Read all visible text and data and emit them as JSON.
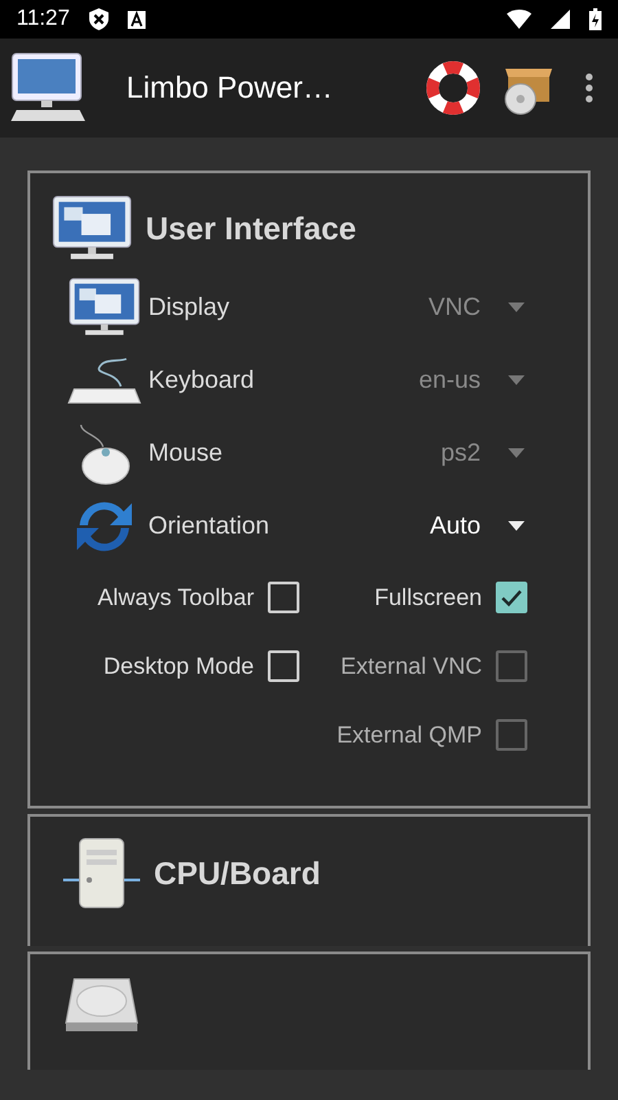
{
  "status_bar": {
    "time": "11:27"
  },
  "app_bar": {
    "title": "Limbo Power…"
  },
  "sections": [
    {
      "kind": "settings",
      "title": "User Interface",
      "dropdowns": [
        {
          "label": "Display",
          "value": "VNC",
          "disabled": true
        },
        {
          "label": "Keyboard",
          "value": "en-us",
          "disabled": true
        },
        {
          "label": "Mouse",
          "value": "ps2",
          "disabled": true
        },
        {
          "label": "Orientation",
          "value": "Auto",
          "disabled": false
        }
      ],
      "checkboxes": [
        {
          "label": "Always Toolbar",
          "checked": false,
          "disabled": false
        },
        {
          "label": "Fullscreen",
          "checked": true,
          "disabled": false
        },
        {
          "label": "Desktop Mode",
          "checked": false,
          "disabled": false
        },
        {
          "label": "External VNC",
          "checked": false,
          "disabled": true
        },
        {
          "label": "External QMP",
          "checked": false,
          "disabled": true
        }
      ]
    },
    {
      "kind": "header",
      "title": "CPU/Board"
    },
    {
      "kind": "header"
    }
  ]
}
